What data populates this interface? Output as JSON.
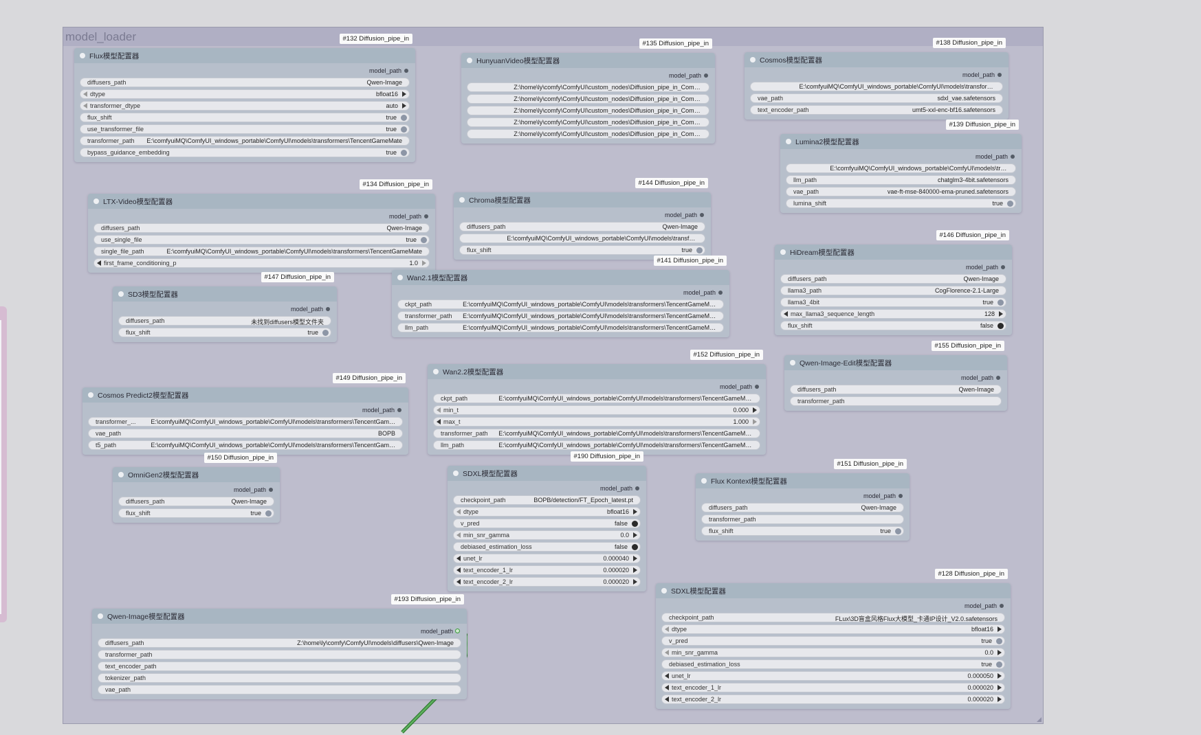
{
  "group": {
    "title": "model_loader"
  },
  "nodes": [
    {
      "key": "flux",
      "id_badge": "#132 Diffusion_pipe_in",
      "title": "Flux模型配置器",
      "output": "model_path",
      "widgets": [
        {
          "type": "path",
          "name": "diffusers_path",
          "value": "Qwen-Image"
        },
        {
          "type": "combo",
          "name": "dtype",
          "value": "bfloat16"
        },
        {
          "type": "combo",
          "name": "transformer_dtype",
          "value": "auto"
        },
        {
          "type": "toggle",
          "name": "flux_shift",
          "value": "true",
          "on": true
        },
        {
          "type": "toggle",
          "name": "use_transformer_file",
          "value": "true",
          "on": true
        },
        {
          "type": "path",
          "name": "transformer_path",
          "value": "E:\\comfyuiMQ\\ComfyUI_windows_portable\\ComfyUI\\models\\transformers\\TencentGameMate"
        },
        {
          "type": "toggle",
          "name": "bypass_guidance_embedding",
          "value": "true",
          "on": true
        }
      ]
    },
    {
      "key": "hunyuan",
      "id_badge": "#135 Diffusion_pipe_in",
      "title": "HunyuanVideo模型配置器",
      "output": "model_path",
      "widgets": [
        {
          "type": "path",
          "name": "",
          "value": "Z:\\home\\ly\\comfy\\ComfyUI\\custom_nodes\\Diffusion_pipe_in_ComfyUI\\Qwen-Ima..."
        },
        {
          "type": "path",
          "name": "",
          "value": "Z:\\home\\ly\\comfy\\ComfyUI\\custom_nodes\\Diffusion_pipe_in_ComfyUI\\Qwen-Ima..."
        },
        {
          "type": "path",
          "name": "",
          "value": "Z:\\home\\ly\\comfy\\ComfyUI\\custom_nodes\\Diffusion_pipe_in_ComfyUI\\Qwen-Ima..."
        },
        {
          "type": "path",
          "name": "",
          "value": "Z:\\home\\ly\\comfy\\ComfyUI\\custom_nodes\\Diffusion_pipe_in_ComfyUI\\Qwen-Ima..."
        },
        {
          "type": "path",
          "name": "",
          "value": "Z:\\home\\ly\\comfy\\ComfyUI\\custom_nodes\\Diffusion_pipe_in_ComfyUI\\Qwen-Ima..."
        }
      ]
    },
    {
      "key": "cosmos",
      "id_badge": "#138 Diffusion_pipe_in",
      "title": "Cosmos模型配置器",
      "output": "model_path",
      "widgets": [
        {
          "type": "path",
          "name": "",
          "value": "E:\\comfyuiMQ\\ComfyUI_windows_portable\\ComfyUI\\models\\transformers\\TencentG ..."
        },
        {
          "type": "path",
          "name": "vae_path",
          "value": "sdxl_vae.safetensors"
        },
        {
          "type": "path",
          "name": "text_encoder_path",
          "value": "umt5-xxl-enc-bf16.safetensors"
        }
      ]
    },
    {
      "key": "lumina2",
      "id_badge": "#139 Diffusion_pipe_in",
      "title": "Lumina2模型配置器",
      "output": "model_path",
      "widgets": [
        {
          "type": "path",
          "name": "",
          "value": "E:\\comfyuiMQ\\ComfyUI_windows_portable\\ComfyUI\\models\\transformers\\Te ..."
        },
        {
          "type": "path",
          "name": "llm_path",
          "value": "chatglm3-4bit.safetensors"
        },
        {
          "type": "path",
          "name": "vae_path",
          "value": "vae-ft-mse-840000-ema-pruned.safetensors"
        },
        {
          "type": "toggle",
          "name": "lumina_shift",
          "value": "true",
          "on": true
        }
      ]
    },
    {
      "key": "ltx",
      "id_badge": "#134 Diffusion_pipe_in",
      "title": "LTX-Video模型配置器",
      "output": "model_path",
      "widgets": [
        {
          "type": "path",
          "name": "diffusers_path",
          "value": "Qwen-Image"
        },
        {
          "type": "toggle",
          "name": "use_single_file",
          "value": "true",
          "on": true
        },
        {
          "type": "path",
          "name": "single_file_path",
          "value": "E:\\comfyuiMQ\\ComfyUI_windows_portable\\ComfyUI\\models\\transformers\\TencentGameMate"
        },
        {
          "type": "combo",
          "name": "first_frame_conditioning_p",
          "value": "1.0",
          "dark_left": true,
          "light_right": true
        }
      ]
    },
    {
      "key": "chroma",
      "id_badge": "#144 Diffusion_pipe_in",
      "title": "Chroma模型配置器",
      "output": "model_path",
      "widgets": [
        {
          "type": "path",
          "name": "diffusers_path",
          "value": "Qwen-Image"
        },
        {
          "type": "path",
          "name": "",
          "value": "E:\\comfyuiMQ\\ComfyUI_windows_portable\\ComfyUI\\models\\transformers\\Tencent ..."
        },
        {
          "type": "toggle",
          "name": "flux_shift",
          "value": "true",
          "on": true
        }
      ]
    },
    {
      "key": "hidream",
      "id_badge": "#146 Diffusion_pipe_in",
      "title": "HiDream模型配置器",
      "output": "model_path",
      "widgets": [
        {
          "type": "path",
          "name": "diffusers_path",
          "value": "Qwen-Image"
        },
        {
          "type": "path",
          "name": "llama3_path",
          "value": "CogFlorence-2.1-Large"
        },
        {
          "type": "toggle",
          "name": "llama3_4bit",
          "value": "true",
          "on": true
        },
        {
          "type": "combo",
          "name": "max_llama3_sequence_length",
          "value": "128",
          "dark_left": true
        },
        {
          "type": "toggle",
          "name": "flux_shift",
          "value": "false",
          "on": false
        }
      ]
    },
    {
      "key": "sd3",
      "id_badge": "#147 Diffusion_pipe_in",
      "title": "SD3模型配置器",
      "output": "model_path",
      "widgets": [
        {
          "type": "path",
          "name": "diffusers_path",
          "value": "未找到diffusers模型文件夹"
        },
        {
          "type": "toggle",
          "name": "flux_shift",
          "value": "true",
          "on": true
        }
      ]
    },
    {
      "key": "wan21",
      "id_badge": "#141 Diffusion_pipe_in",
      "title": "Wan2.1模型配置器",
      "output": "model_path",
      "widgets": [
        {
          "type": "path",
          "name": "ckpt_path",
          "value": "E:\\comfyuiMQ\\ComfyUI_windows_portable\\ComfyUI\\models\\transformers\\TencentGameMate"
        },
        {
          "type": "path",
          "name": "transformer_path",
          "value": "E:\\comfyuiMQ\\ComfyUI_windows_portable\\ComfyUI\\models\\transformers\\TencentGameMate"
        },
        {
          "type": "path",
          "name": "llm_path",
          "value": "E:\\comfyuiMQ\\ComfyUI_windows_portable\\ComfyUI\\models\\transformers\\TencentGameMate"
        }
      ]
    },
    {
      "key": "qwenedit",
      "id_badge": "#155 Diffusion_pipe_in",
      "title": "Qwen-Image-Edit模型配置器",
      "output": "model_path",
      "widgets": [
        {
          "type": "path",
          "name": "diffusers_path",
          "value": "Qwen-Image"
        },
        {
          "type": "path",
          "name": "transformer_path",
          "value": ""
        }
      ]
    },
    {
      "key": "cosmos2",
      "id_badge": "#149 Diffusion_pipe_in",
      "title": "Cosmos Predict2模型配置器",
      "output": "model_path",
      "widgets": [
        {
          "type": "path",
          "name": "transformer_...",
          "value": "E:\\comfyuiMQ\\ComfyUI_windows_portable\\ComfyUI\\models\\transformers\\TencentGameMate"
        },
        {
          "type": "path",
          "name": "vae_path",
          "value": "BOPB"
        },
        {
          "type": "path",
          "name": "t5_path",
          "value": "E:\\comfyuiMQ\\ComfyUI_windows_portable\\ComfyUI\\models\\transformers\\TencentGameMate"
        }
      ]
    },
    {
      "key": "wan22",
      "id_badge": "#152 Diffusion_pipe_in",
      "title": "Wan2.2模型配置器",
      "output": "model_path",
      "widgets": [
        {
          "type": "path",
          "name": "ckpt_path",
          "value": "E:\\comfyuiMQ\\ComfyUI_windows_portable\\ComfyUI\\models\\transformers\\TencentGameMate"
        },
        {
          "type": "combo",
          "name": "min_t",
          "value": "0.000"
        },
        {
          "type": "combo",
          "name": "max_t",
          "value": "1.000",
          "dark_left": true,
          "light_right": true
        },
        {
          "type": "path",
          "name": "transformer_path",
          "value": "E:\\comfyuiMQ\\ComfyUI_windows_portable\\ComfyUI\\models\\transformers\\TencentGameMate"
        },
        {
          "type": "path",
          "name": "llm_path",
          "value": "E:\\comfyuiMQ\\ComfyUI_windows_portable\\ComfyUI\\models\\transformers\\TencentGameMate"
        }
      ]
    },
    {
      "key": "omnigen2",
      "id_badge": "#150 Diffusion_pipe_in",
      "title": "OmniGen2模型配置器",
      "output": "model_path",
      "widgets": [
        {
          "type": "path",
          "name": "diffusers_path",
          "value": "Qwen-Image"
        },
        {
          "type": "toggle",
          "name": "flux_shift",
          "value": "true",
          "on": true
        }
      ]
    },
    {
      "key": "sdxl1",
      "id_badge": "#190 Diffusion_pipe_in",
      "title": "SDXL模型配置器",
      "output": "model_path",
      "widgets": [
        {
          "type": "path",
          "name": "checkpoint_path",
          "value": "BOPB/detection/FT_Epoch_latest.pt"
        },
        {
          "type": "combo",
          "name": "dtype",
          "value": "bfloat16"
        },
        {
          "type": "toggle",
          "name": "v_pred",
          "value": "false",
          "on": false
        },
        {
          "type": "combo",
          "name": "min_snr_gamma",
          "value": "0.0"
        },
        {
          "type": "toggle",
          "name": "debiased_estimation_loss",
          "value": "false",
          "on": false
        },
        {
          "type": "combo",
          "name": "unet_lr",
          "value": "0.000040",
          "dark_left": true
        },
        {
          "type": "combo",
          "name": "text_encoder_1_lr",
          "value": "0.000020",
          "dark_left": true
        },
        {
          "type": "combo",
          "name": "text_encoder_2_lr",
          "value": "0.000020",
          "dark_left": true
        }
      ]
    },
    {
      "key": "fluxkontext",
      "id_badge": "#151 Diffusion_pipe_in",
      "title": "Flux Kontext模型配置器",
      "output": "model_path",
      "widgets": [
        {
          "type": "path",
          "name": "diffusers_path",
          "value": "Qwen-Image"
        },
        {
          "type": "path",
          "name": "transformer_path",
          "value": ""
        },
        {
          "type": "toggle",
          "name": "flux_shift",
          "value": "true",
          "on": true
        }
      ]
    },
    {
      "key": "sdxl2",
      "id_badge": "#128 Diffusion_pipe_in",
      "title": "SDXL模型配置器",
      "output": "model_path",
      "widgets": [
        {
          "type": "path",
          "name": "checkpoint_path",
          "value": "FLux\\3D盲盒风格Flux大模型_卡通IP设计_V2.0.safetensors"
        },
        {
          "type": "combo",
          "name": "dtype",
          "value": "bfloat16"
        },
        {
          "type": "toggle",
          "name": "v_pred",
          "value": "true",
          "on": true
        },
        {
          "type": "combo",
          "name": "min_snr_gamma",
          "value": "0.0"
        },
        {
          "type": "toggle",
          "name": "debiased_estimation_loss",
          "value": "true",
          "on": true
        },
        {
          "type": "combo",
          "name": "unet_lr",
          "value": "0.000050",
          "dark_left": true
        },
        {
          "type": "combo",
          "name": "text_encoder_1_lr",
          "value": "0.000020",
          "dark_left": true
        },
        {
          "type": "combo",
          "name": "text_encoder_2_lr",
          "value": "0.000020",
          "dark_left": true
        }
      ]
    },
    {
      "key": "qwenimage",
      "id_badge": "#193 Diffusion_pipe_in",
      "title": "Qwen-Image模型配置器",
      "output": "model_path",
      "output_connected": true,
      "widgets": [
        {
          "type": "path",
          "name": "diffusers_path",
          "value": "Z:\\home\\ly\\comfy\\ComfyUI\\models\\diffusers\\Qwen-Image"
        },
        {
          "type": "path",
          "name": "transformer_path",
          "value": ""
        },
        {
          "type": "path",
          "name": "text_encoder_path",
          "value": ""
        },
        {
          "type": "path",
          "name": "tokenizer_path",
          "value": ""
        },
        {
          "type": "path",
          "name": "vae_path",
          "value": ""
        }
      ]
    }
  ],
  "colors": {
    "wire": "#3f8f3f",
    "group_bg": "#bebdcd",
    "node_bg": "#b7bfcb",
    "node_header": "#a8b6c2"
  }
}
